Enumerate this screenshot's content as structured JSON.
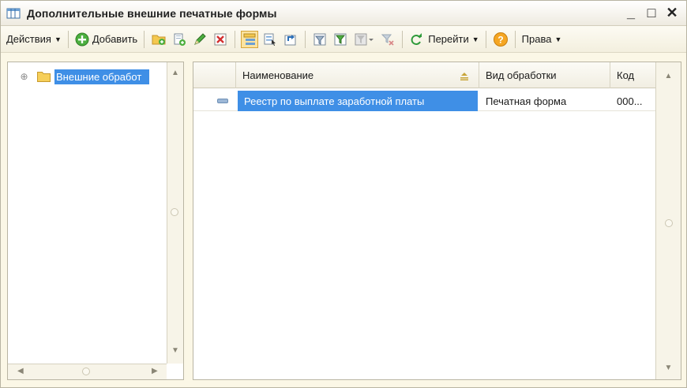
{
  "window": {
    "title": "Дополнительные внешние печатные формы",
    "controls": {
      "minimize": "_",
      "maximize": "□",
      "close": "✕"
    }
  },
  "toolbar": {
    "actions_label": "Действия",
    "add_label_prefix": "Д",
    "add_label_rest": "обавить",
    "goto_label": "Перейти",
    "rights_label": "Права",
    "icons": [
      "new-folder-icon",
      "copy-icon",
      "edit-pencil-icon",
      "delete-mark-icon",
      "hierarchy-view-icon",
      "tree-list-icon",
      "move-to-parent-icon",
      "filter-icon",
      "filter-by-value-icon",
      "filter-history-icon",
      "clear-filter-icon",
      "refresh-icon",
      "help-icon"
    ]
  },
  "tree": {
    "root_label": "Внешние обработ"
  },
  "table": {
    "columns": [
      "Наименование",
      "Вид обработки",
      "Код"
    ],
    "rows": [
      {
        "name": "Реестр по выплате заработной платы",
        "type": "Печатная форма",
        "code": "000..."
      }
    ]
  },
  "colors": {
    "selection": "#3f8fe6",
    "background": "#fbf7e6",
    "pressed_button": "#fbe3a0"
  }
}
